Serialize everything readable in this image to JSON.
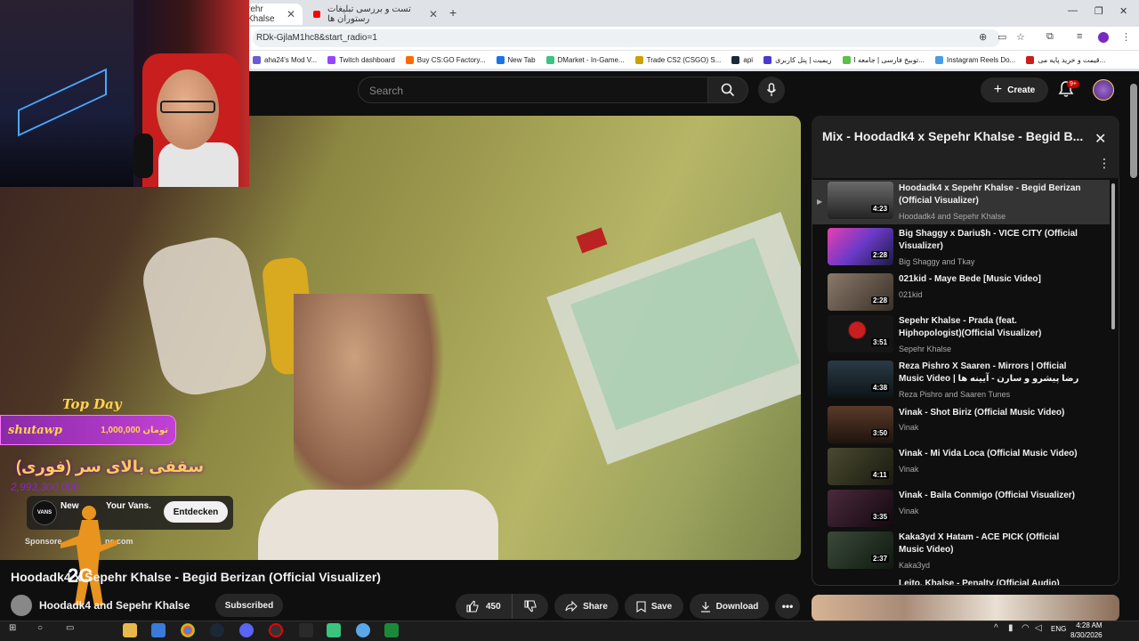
{
  "browser": {
    "tabs": [
      {
        "label": "rehr Khalse"
      },
      {
        "label": "تست و بررسی تبلیغات رستوران ها"
      }
    ],
    "url": "RDk-GjlaM1hc8&start_radio=1",
    "bookmarks": [
      {
        "label": "aha24's Mod V...",
        "color": "#6b5bd6"
      },
      {
        "label": "Twitch dashboard",
        "color": "#9146ff"
      },
      {
        "label": "Buy CS:GO Factory...",
        "color": "#ff6a00"
      },
      {
        "label": "New Tab",
        "color": "#1a73e8"
      },
      {
        "label": "DMarket - In-Game...",
        "color": "#3ac47d"
      },
      {
        "label": "Trade CS2 (CSGO) S...",
        "color": "#c9a200"
      },
      {
        "label": "api",
        "color": "#1b2838"
      },
      {
        "label": "ریمیت | پنل کاربری",
        "color": "#4b3ad1"
      },
      {
        "label": "توبیخ فارسی | جامعه ا...",
        "color": "#5bbf4a"
      },
      {
        "label": "Instagram Reels Do...",
        "color": "#4a9be8"
      },
      {
        "label": "قیمت و خرید پایه می...",
        "color": "#cc1b1b"
      }
    ]
  },
  "youtube": {
    "search_placeholder": "Search",
    "create_label": "Create",
    "notif_badge": "9+"
  },
  "overlay": {
    "top_day": "Top Day",
    "donor": "shutawp",
    "amount": "تومان 1,000,000",
    "goal_text": "سقفی بالای سر (فوری)",
    "goal_sub": "2,993,300,000"
  },
  "ad": {
    "logo": "VANS",
    "text_left": "New",
    "text_right": "Your Vans.",
    "cta": "Entdecken",
    "sponsored": "Sponsore",
    "domain": "ns.com"
  },
  "video": {
    "title": "Hoodadk4 x Sepehr Khalse - Begid Berizan (Official Visualizer)",
    "channel": "Hoodadk4 and Sepehr Khalse",
    "subscribe_label": "Subscribed",
    "likes": "450",
    "share_label": "Share",
    "save_label": "Save",
    "download_label": "Download"
  },
  "playlist": {
    "title": "Mix - Hoodadk4 x Sepehr Khalse - Begid B...",
    "items": [
      {
        "title": "Hoodadk4 x Sepehr Khalse - Begid Berizan (Official Visualizer)",
        "channel": "Hoodadk4 and Sepehr Khalse",
        "duration": "4:23",
        "thumb": "#3a3a3a"
      },
      {
        "title": "Big Shaggy x Dariu$h - VICE CITY (Official Visualizer)",
        "channel": "Big Shaggy and Tkay",
        "duration": "2:28",
        "thumb": "#8a3ab8"
      },
      {
        "title": "021kid - Maye Bede [Music Video]",
        "channel": "021kid",
        "duration": "2:28",
        "thumb": "#5a4a3a"
      },
      {
        "title": "Sepehr Khalse - Prada (feat. Hiphopologist)(Official Visualizer)",
        "channel": "Sepehr Khalse",
        "duration": "3:51",
        "thumb": "#1a1a1a"
      },
      {
        "title": "Reza Pishro X Saaren - Mirrors | Official Music Video | رضا پیشرو و سارن - آیینه ها",
        "channel": "Reza Pishro and Saaren Tunes",
        "duration": "4:38",
        "thumb": "#1f2a30"
      },
      {
        "title": "Vinak - Shot Biriz (Official Music Video)",
        "channel": "Vinak",
        "duration": "3:50",
        "thumb": "#3a2a20"
      },
      {
        "title": "Vinak - Mi Vida Loca (Official Music Video)",
        "channel": "Vinak",
        "duration": "4:11",
        "thumb": "#3a3a2a"
      },
      {
        "title": "Vinak - Baila Conmigo (Official Visualizer)",
        "channel": "Vinak",
        "duration": "3:35",
        "thumb": "#2a1a2a"
      },
      {
        "title": "Kaka3yd X Hatam - ACE PICK (Official Music Video)",
        "channel": "Kaka3yd",
        "duration": "2:37",
        "thumb": "#2a3a30"
      },
      {
        "title": "Leito, Khalse - Penalty (Official Audio)",
        "channel": "",
        "duration": "",
        "thumb": "#333"
      }
    ]
  },
  "taskbar": {
    "lang": "ENG",
    "time": "4:28 AM",
    "date": "8/30/2026"
  }
}
